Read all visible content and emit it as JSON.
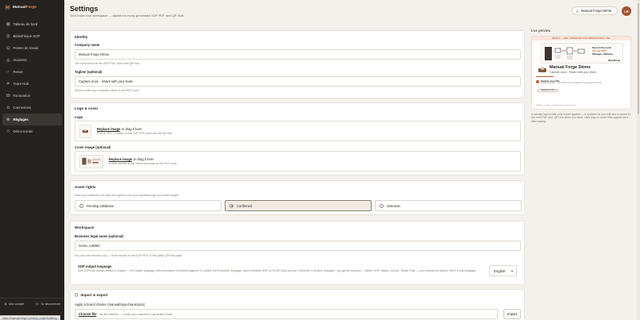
{
  "brand": {
    "name_prefix": "Manual",
    "name_accent": "Forge"
  },
  "sidebar": {
    "items": [
      {
        "label": "Tableau de bord",
        "icon": "dashboard-icon"
      },
      {
        "label": "Bibliothèque SOP",
        "icon": "library-icon"
      },
      {
        "label": "Postes de travail",
        "icon": "workstation-icon"
      },
      {
        "label": "Incidents",
        "icon": "alert-icon"
      },
      {
        "label": "Revue",
        "icon": "review-icon"
      },
      {
        "label": "Team Hub",
        "icon": "team-icon"
      },
      {
        "label": "Facturation",
        "icon": "billing-icon"
      },
      {
        "label": "Connexions",
        "icon": "plug-icon"
      },
      {
        "label": "Réglages",
        "icon": "gear-icon"
      },
      {
        "label": "Démo terrain",
        "icon": "demo-icon"
      }
    ],
    "active_index": 8,
    "account_label": "Mon compte",
    "logout_label": "Se déconnecter"
  },
  "status_url": "https://manual-forge.com/sop-projects/billing",
  "header": {
    "title": "Settings",
    "subtitle": "Your brand and workspace — applied to every generated SOP PDF and QR Hub.",
    "user_label": "Manual Forge Démo",
    "avatar_initials": "LB"
  },
  "identity": {
    "title": "Identity",
    "company_label": "Company name",
    "company_value": "Manual Forge Démo",
    "company_help": "The main brand on the SOP PDF cover and QR Hub.",
    "tagline_label": "Tagline (optional)",
    "tagline_value": "Capture once · Share with your team",
    "tagline_help": "Shown under your company name on the PDF cover."
  },
  "logo_cover": {
    "title": "Logo & cover",
    "logo_label": "Logo",
    "replace_text": "Replace image",
    "drag_text": " or drag it here",
    "logo_help": "PNG or JPG — shown on the SOP PDF cover and the QR Hub.",
    "cover_label": "Cover image (optional)",
    "cover_help": "A wider banner shown above your logo on the PDF cover."
  },
  "asset_rights": {
    "title": "Asset rights",
    "question": "Have you confirmed you have the rights to use your uploaded logo and cover image?",
    "options": [
      "Pending validation",
      "Confirmed",
      "Unknown"
    ],
    "selected_index": 1
  },
  "workspace": {
    "title": "Workspace",
    "legal_label": "Business legal name (optional)",
    "legal_value": "SASU LUBMC",
    "legal_help": "For your own records only — never shown on the SOP PDF or the public QR Hub page.",
    "lang_label": "SOP output language",
    "lang_help": "New SOPs are always drafted in English — the master language every translation is checked against. To publish one in another language, open a finished SOP (or its QR Hub) and use \"Generate in another language\": you get the full pack — Master SOP, Station Job Aid, Trainer Pack — your photos and videos, 100% in that language.",
    "lang_value": "English"
  },
  "import_export": {
    "title": "Import & export",
    "charter_label": "Apply a brand charter (manualforge-brand.json)",
    "choose_file": "Choose file",
    "file_status": "No file selected — a small .json exported or generated below.",
    "import_button": "Import"
  },
  "preview": {
    "title": "Live preview",
    "draft_banner": "DRAFT — NOT APPROVED FOR OPERATIONAL USE",
    "tagline_line1": "Record the work.",
    "tagline_line2": "Get the SOP.",
    "tagline_line3": "Manager validates.",
    "mini_brand": "ManualForge",
    "company": "Manual Forge Démo",
    "tag": "Capture once · Share with your team",
    "step_title": "Sample step title",
    "step_desc": "Sample body text — your SOP content is written by the generator. Not final.",
    "equipment": "Equipment used",
    "footer": "QR Hub — Draft — not approved for operational use",
    "note": "A sample layout with your brand applied — it updates as you edit and is saved to the next PDF and QR Hub when you save. New logo or cover files appear here after saving."
  }
}
